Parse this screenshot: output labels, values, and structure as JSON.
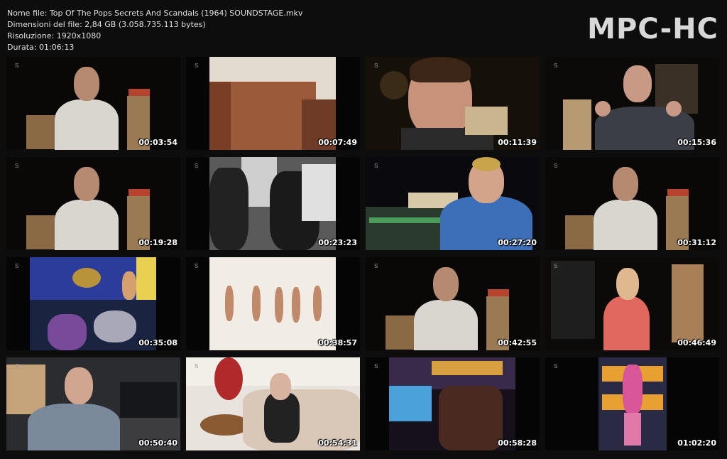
{
  "file_info": {
    "name_line": "Nome file: Top Of The Pops Secrets And Scandals (1964) SOUNDSTAGE.mkv",
    "size_line": "Dimensioni del file: 2,84 GB (3.058.735.113 bytes)",
    "resolution_line": "Risoluzione: 1920x1080",
    "duration_line": "Durata: 01:06:13"
  },
  "logo": "MPC-HC",
  "thumbnails": [
    {
      "time": "00:03:54",
      "scene": "interview-man-boxes"
    },
    {
      "time": "00:07:49",
      "scene": "bbc-building"
    },
    {
      "time": "00:11:39",
      "scene": "man-smiling-closeup"
    },
    {
      "time": "00:15:36",
      "scene": "older-man-gesturing"
    },
    {
      "time": "00:19:28",
      "scene": "interview-man-boxes"
    },
    {
      "time": "00:23:23",
      "scene": "archive-bw"
    },
    {
      "time": "00:27:20",
      "scene": "man-blue-suit-studio"
    },
    {
      "time": "00:31:12",
      "scene": "interview-man-boxes"
    },
    {
      "time": "00:35:08",
      "scene": "drummer-stage"
    },
    {
      "time": "00:38:57",
      "scene": "dancers-white"
    },
    {
      "time": "00:42:55",
      "scene": "interview-man-boxes"
    },
    {
      "time": "00:46:49",
      "scene": "woman-pink-dress"
    },
    {
      "time": "00:50:40",
      "scene": "man-glasses-desk"
    },
    {
      "time": "00:54:31",
      "scene": "old-man-sofa"
    },
    {
      "time": "00:58:28",
      "scene": "disco-stage"
    },
    {
      "time": "01:02:20",
      "scene": "totp-logo-performer"
    }
  ],
  "watermark": "S"
}
